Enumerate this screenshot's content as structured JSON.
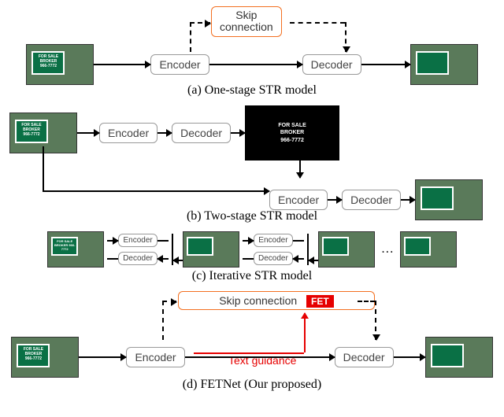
{
  "common": {
    "encoder": "Encoder",
    "decoder": "Decoder",
    "skip": "Skip\nconnection",
    "sign_text": "FOR SALE\nBROKER\n966-7772"
  },
  "a": {
    "caption": "(a) One-stage STR model"
  },
  "b": {
    "caption": "(b) Two-stage STR model",
    "mask_text": "FOR SALE\nBROKER\n966-7772"
  },
  "c": {
    "caption": "(c) Iterative STR model"
  },
  "d": {
    "caption": "(d) FETNet (Our proposed)",
    "fet": "FET",
    "guidance": "Text guidance"
  }
}
